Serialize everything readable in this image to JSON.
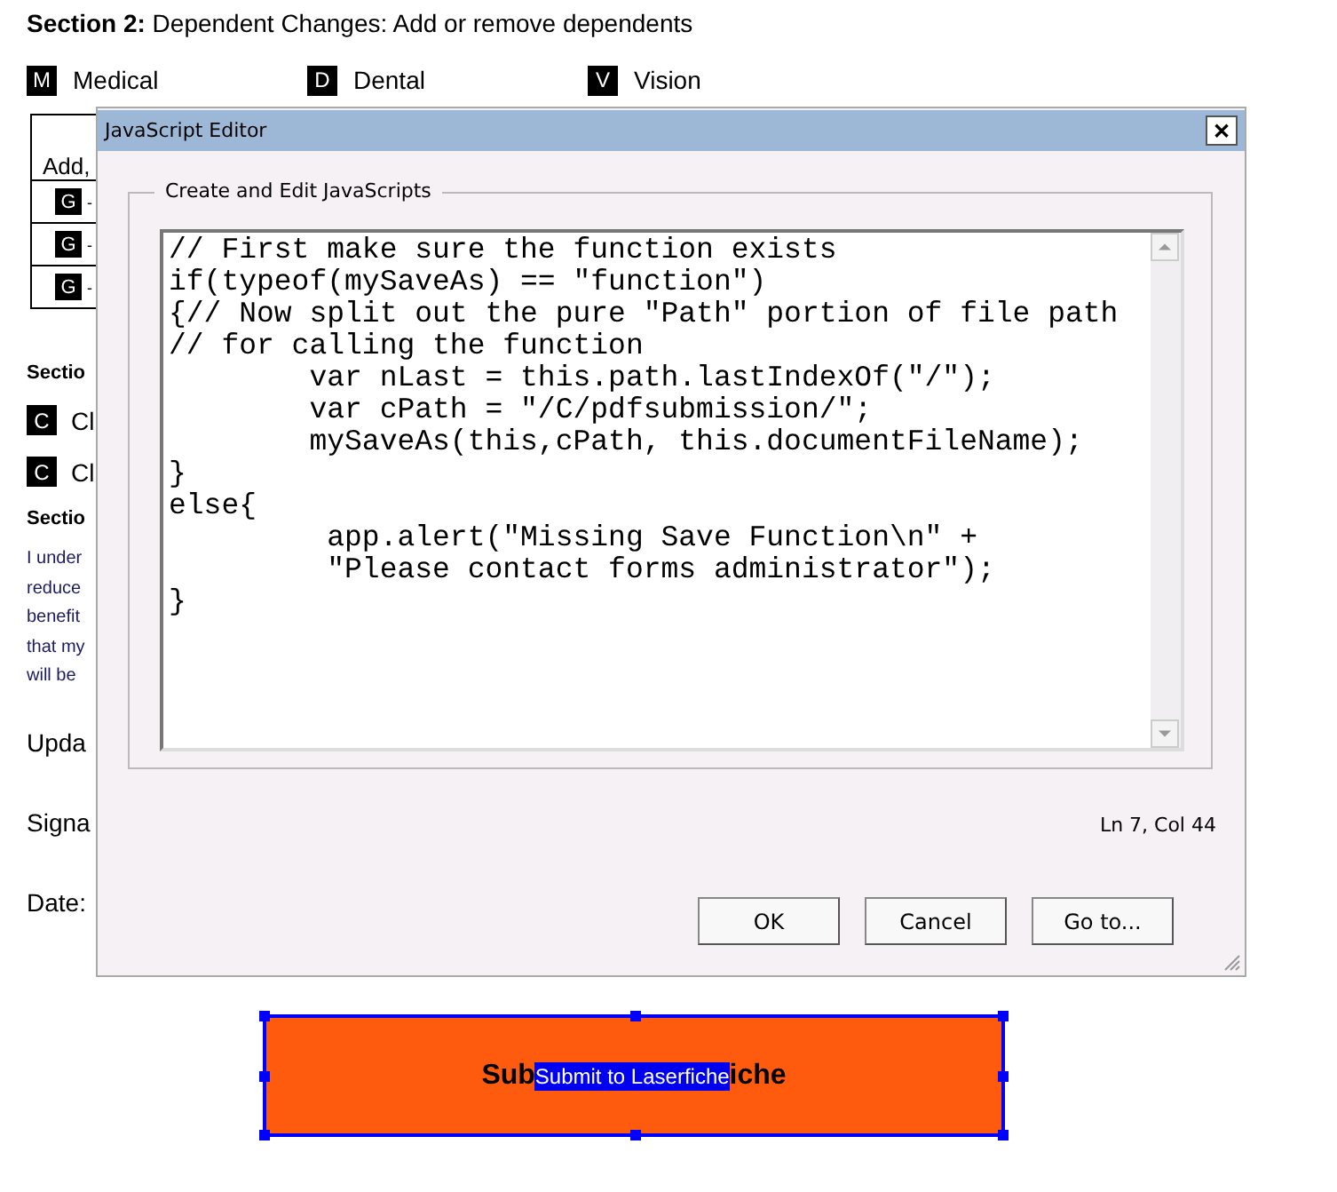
{
  "form": {
    "section_title_bold": "Section 2:",
    "section_title": "Dependent Changes: Add or remove dependents",
    "coverage": [
      {
        "icon_text": "M",
        "label": "Medical",
        "checked": true
      },
      {
        "icon_text": "D",
        "label": "Dental",
        "checked": true
      },
      {
        "icon_text": "V",
        "label": "Vision",
        "checked": true
      }
    ],
    "table": {
      "header": "Add,",
      "rows": [
        {
          "icon_text": "G",
          "mark": "-",
          "checked": true
        },
        {
          "icon_text": "G",
          "mark": "-",
          "checked": true
        },
        {
          "icon_text": "G",
          "mark": "-",
          "checked": true
        }
      ]
    },
    "section_3": "Sectio",
    "changes": [
      {
        "icon_text": "C",
        "label": "Cl",
        "checked": true
      },
      {
        "icon_text": "C",
        "label": "Cl",
        "checked": true
      }
    ],
    "section_4": "Sectio",
    "paragraph": [
      "I under",
      "reduce",
      "benefit",
      "that my",
      "will be"
    ],
    "fields": [
      "Upda",
      "Signa",
      "Date:"
    ]
  },
  "dialog": {
    "title": "JavaScript Editor",
    "close": "✕",
    "group_label": "Create and Edit JavaScripts",
    "code": [
      "// First make sure the function exists",
      "if(typeof(mySaveAs) == \"function\")",
      "{// Now split out the pure \"Path\" portion of file path",
      "// for calling the function",
      "        var nLast = this.path.lastIndexOf(\"/\");",
      "        var cPath = \"/C/pdfsubmission/\";",
      "        mySaveAs(this,cPath, this.documentFileName);",
      "}",
      "else{",
      "         app.alert(\"Missing Save Function\\n\" +",
      "         \"Please contact forms administrator\");",
      "}"
    ],
    "status": "Ln 7, Col 44",
    "buttons": [
      "OK",
      "Cancel",
      "Go to..."
    ]
  },
  "submit_button": {
    "label_before": "Sub",
    "selected_text": "Submit to Laserfiche",
    "label_after": "iche",
    "selected": true
  }
}
